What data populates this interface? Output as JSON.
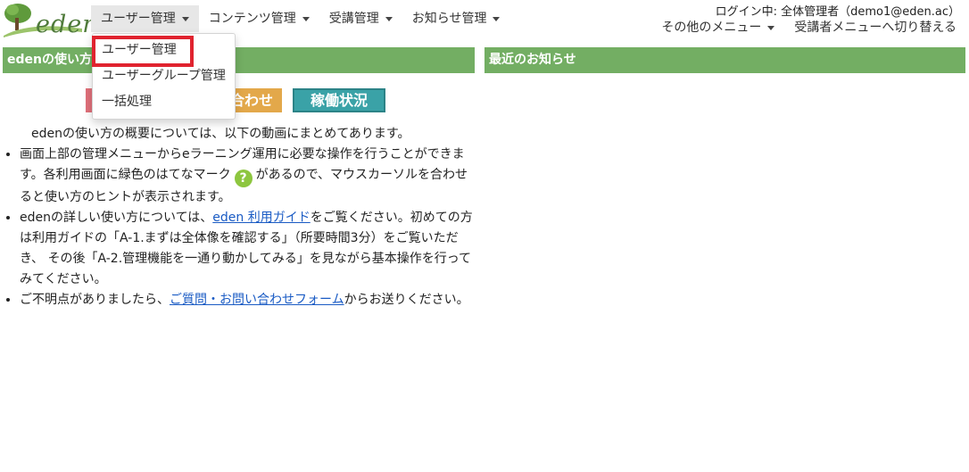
{
  "brand": {
    "logo_text": "eden"
  },
  "nav": {
    "items": [
      {
        "label": "ユーザー管理"
      },
      {
        "label": "コンテンツ管理"
      },
      {
        "label": "受講管理"
      },
      {
        "label": "お知らせ管理"
      }
    ]
  },
  "header": {
    "login_info": "ログイン中: 全体管理者（demo1@eden.ac）",
    "other_menu": "その他のメニュー",
    "switch_menu": "受講者メニューへ切り替える"
  },
  "dropdown": {
    "items": [
      {
        "label": "ユーザー管理"
      },
      {
        "label": "ユーザーグループ管理"
      },
      {
        "label": "一括処理"
      }
    ]
  },
  "left_panel": {
    "title": "edenの使い方",
    "contact_button_partial": "合わせ",
    "status_button": "稼働状況",
    "intro": "edenの使い方の概要については、以下の動画にまとめてあります。",
    "bullet1_a": "画面上部の管理メニューからeラーニング運用に必要な操作を行うことができます。各利用画面に緑色のはてなマーク",
    "bullet1_q": "?",
    "bullet1_b": "があるので、マウスカーソルを合わせると使い方のヒントが表示されます。",
    "bullet2_a": "edenの詳しい使い方については、",
    "bullet2_link": "eden 利用ガイド",
    "bullet2_b": "をご覧ください。初めての方は利用ガイドの「A-1.まずは全体像を確認する」（所要時間3分）をご覧いただき、 その後「A-2.管理機能を一通り動かしてみる」を見ながら基本操作を行ってみてください。",
    "bullet3_a": "ご不明点がありましたら、",
    "bullet3_link": "ご質問・お問い合わせフォーム",
    "bullet3_b": "からお送りください。"
  },
  "right_panel": {
    "title": "最近のお知らせ"
  },
  "colors": {
    "accent_green": "#73ae63",
    "highlight_red": "#e0232f",
    "link_blue": "#1a5bc4"
  }
}
